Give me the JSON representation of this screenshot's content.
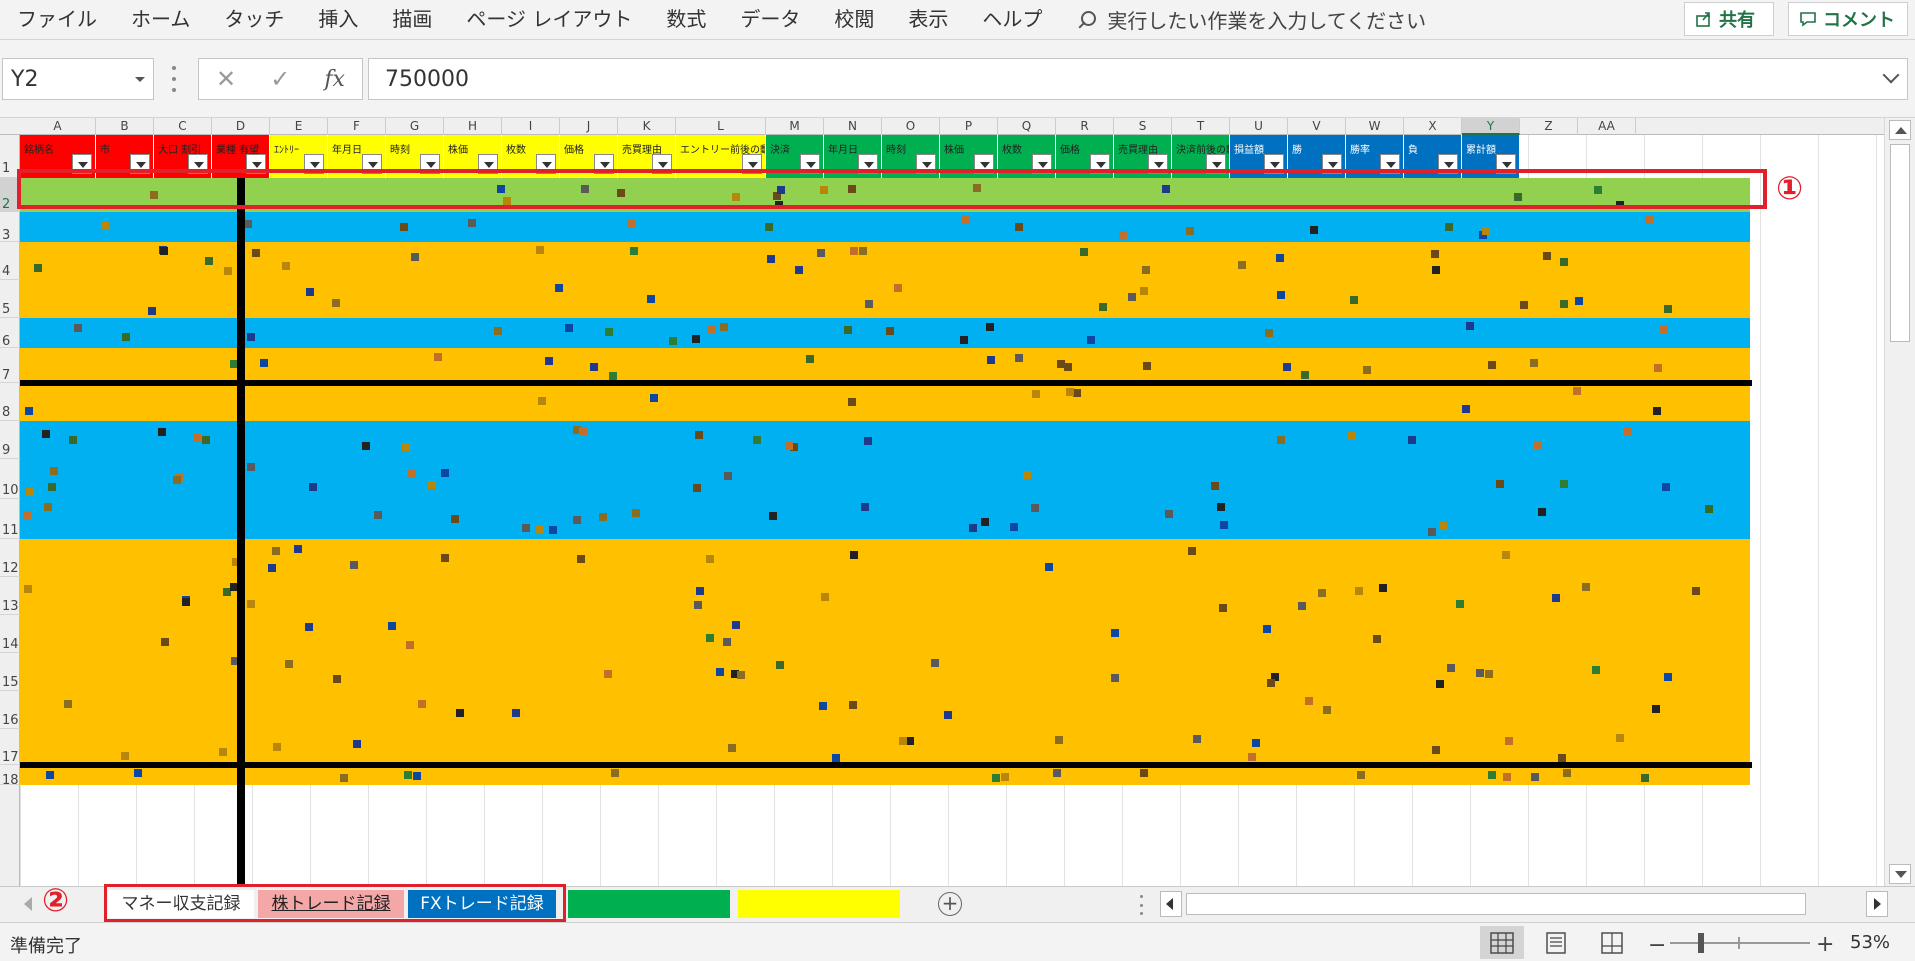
{
  "ribbon": {
    "tabs": [
      "ファイル",
      "ホーム",
      "タッチ",
      "挿入",
      "描画",
      "ページ レイアウト",
      "数式",
      "データ",
      "校閲",
      "表示",
      "ヘルプ"
    ],
    "tell_me": "実行したい作業を入力してください",
    "share": "共有",
    "comment": "コメント"
  },
  "formula_bar": {
    "name_box": "Y2",
    "value": "750000",
    "fx": "fx"
  },
  "sheet": {
    "columns": [
      "A",
      "B",
      "C",
      "D",
      "E",
      "F",
      "G",
      "H",
      "I",
      "J",
      "K",
      "L",
      "M",
      "N",
      "O",
      "P",
      "Q",
      "R",
      "S",
      "T",
      "U",
      "V",
      "W",
      "X",
      "Y",
      "Z",
      "AA"
    ],
    "selected_column": "Y",
    "rows": [
      "1",
      "2",
      "3",
      "4",
      "5",
      "6",
      "7",
      "8",
      "9",
      "10",
      "11",
      "12",
      "13",
      "14",
      "15",
      "16",
      "17",
      "18"
    ],
    "selected_row": "2",
    "headers": [
      {
        "label": "銘柄名",
        "color": "#ff0000"
      },
      {
        "label": "市",
        "color": "#ff0000"
      },
      {
        "label": "大口 割引",
        "color": "#ff0000"
      },
      {
        "label": "業種 有望",
        "color": "#ff0000"
      },
      {
        "label": "ｴﾝﾄﾘｰ",
        "color": "#ffff00"
      },
      {
        "label": "年月日",
        "color": "#ffff00"
      },
      {
        "label": "時刻",
        "color": "#ffff00"
      },
      {
        "label": "株価",
        "color": "#ffff00"
      },
      {
        "label": "枚数",
        "color": "#ffff00"
      },
      {
        "label": "価格",
        "color": "#ffff00"
      },
      {
        "label": "売買理由",
        "color": "#ffff00"
      },
      {
        "label": "エントリー前後の動向",
        "color": "#ffff00"
      },
      {
        "label": "決済",
        "color": "#00b050"
      },
      {
        "label": "年月日",
        "color": "#00b050"
      },
      {
        "label": "時刻",
        "color": "#00b050"
      },
      {
        "label": "株価",
        "color": "#00b050"
      },
      {
        "label": "枚数",
        "color": "#00b050"
      },
      {
        "label": "価格",
        "color": "#00b050"
      },
      {
        "label": "売買理由",
        "color": "#00b050"
      },
      {
        "label": "決済前後の動向",
        "color": "#00b050"
      },
      {
        "label": "損益額",
        "color": "#0070c0"
      },
      {
        "label": "勝",
        "color": "#0070c0"
      },
      {
        "label": "勝率",
        "color": "#0070c0"
      },
      {
        "label": "負",
        "color": "#0070c0"
      },
      {
        "label": "累計額",
        "color": "#0070c0"
      }
    ],
    "annotation_1": "①",
    "annotation_2": "②"
  },
  "sheet_tabs": [
    "マネー収支記録",
    "株トレード記録",
    "FXトレード記録",
    "",
    "",
    ""
  ],
  "sheet_tab_add": "+",
  "status": {
    "ready": "準備完了",
    "zoom": "53%",
    "zoom_minus": "−",
    "zoom_plus": "+"
  },
  "icons": [
    "share-icon",
    "comment-icon",
    "search-icon",
    "normal-view-icon",
    "page-layout-view-icon",
    "page-break-view-icon"
  ]
}
